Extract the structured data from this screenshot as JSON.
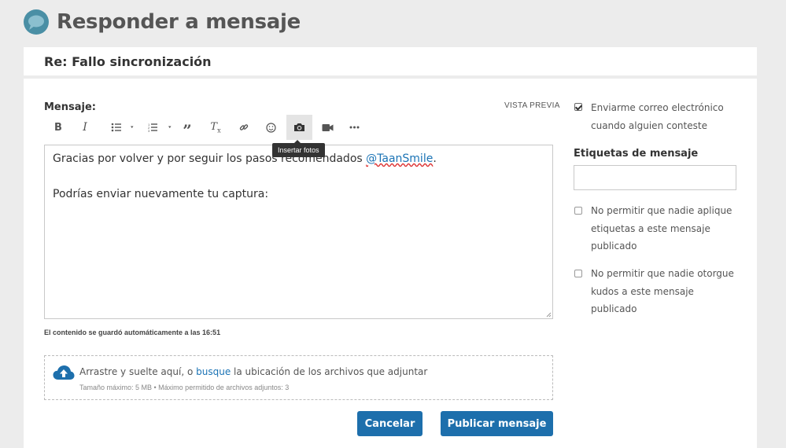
{
  "page": {
    "title": "Responder a mensaje",
    "logo_icon": "chat-bubble-icon",
    "brand_color": "#4a8fa5"
  },
  "subject": "Re: Fallo sincronización",
  "editor": {
    "label": "Mensaje:",
    "preview_label": "VISTA PREVIA",
    "toolbar": [
      {
        "name": "bold",
        "icon": "bold-icon"
      },
      {
        "name": "italic",
        "icon": "italic-icon"
      },
      {
        "name": "bullet-list",
        "icon": "bullet-list-icon"
      },
      {
        "name": "numbered-list",
        "icon": "numbered-list-icon"
      },
      {
        "name": "quote",
        "icon": "quote-icon"
      },
      {
        "name": "clear-format",
        "icon": "clear-format-icon"
      },
      {
        "name": "link",
        "icon": "link-icon"
      },
      {
        "name": "emoji",
        "icon": "emoji-icon"
      },
      {
        "name": "insert-photo",
        "icon": "camera-icon",
        "active": true
      },
      {
        "name": "insert-video",
        "icon": "video-icon"
      },
      {
        "name": "more",
        "icon": "more-icon"
      }
    ],
    "tooltip": "Insertar fotos",
    "line1_text": "Gracias por volver y por seguir los pasos recomendados ",
    "mention": "@TaanSmile",
    "line1_end": ".",
    "line2_text": "Podrías enviar nuevamente tu captura:",
    "autosave_text": "El contenido se guardó automáticamente a las 16:51"
  },
  "dropzone": {
    "text_before": "Arrastre y suelte aquí, o ",
    "browse_link": "busque",
    "text_after": " la ubicación de los archivos que adjuntar",
    "limits": "Tamaño máximo: 5 MB • Máximo permitido de archivos adjuntos: 3"
  },
  "buttons": {
    "cancel": "Cancelar",
    "publish": "Publicar mensaje",
    "color": "#1d6fac"
  },
  "sidebar": {
    "email_option": {
      "checked": true,
      "line1": "Enviarme correo electrónico",
      "line2": "cuando alguien conteste"
    },
    "tags_label": "Etiquetas de mensaje",
    "tags_value": "",
    "no_tags_option": {
      "checked": false,
      "line1": "No permitir que nadie aplique",
      "line2": "etiquetas a este mensaje",
      "line3": "publicado"
    },
    "no_kudos_option": {
      "checked": false,
      "line1": "No permitir que nadie otorgue",
      "line2": "kudos a este mensaje",
      "line3": "publicado"
    }
  }
}
